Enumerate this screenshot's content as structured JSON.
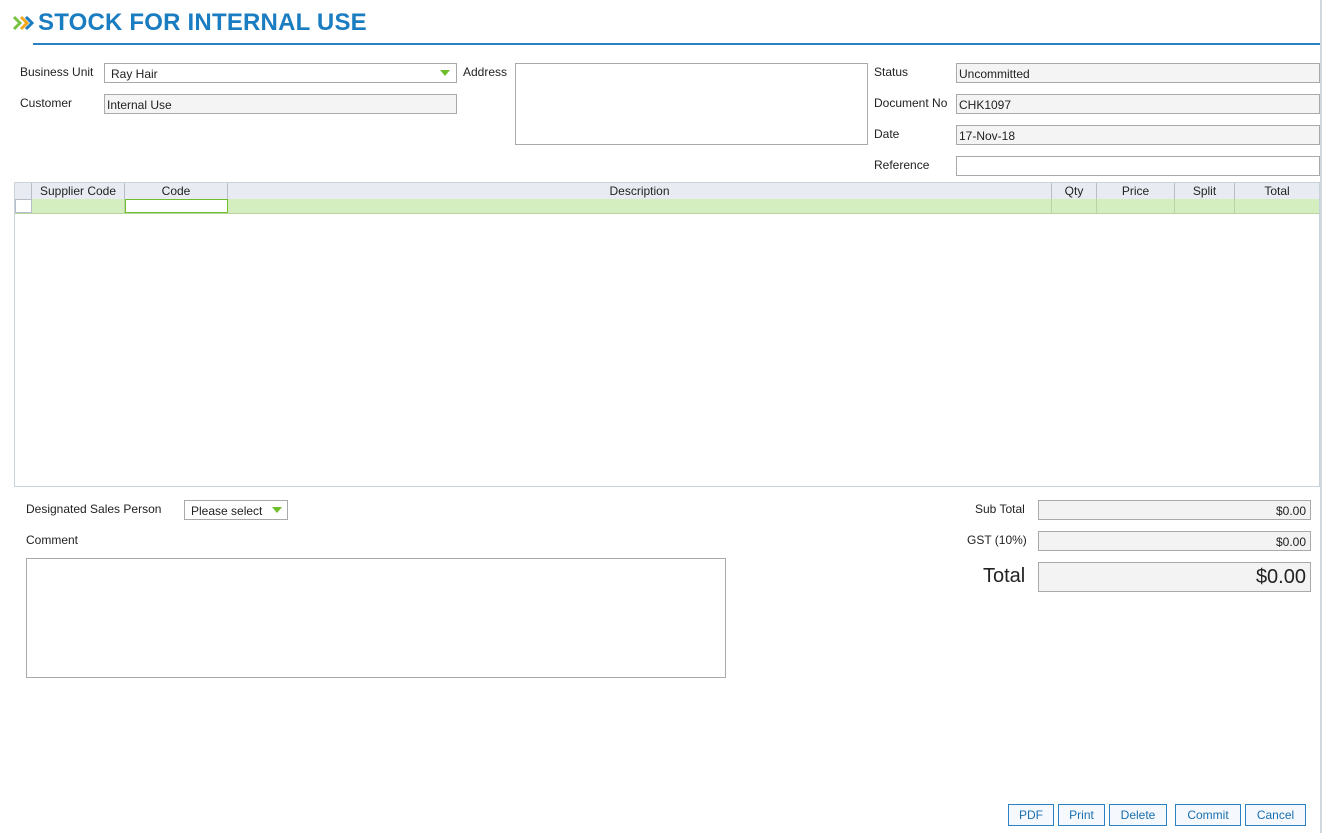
{
  "header": {
    "title": "STOCK FOR INTERNAL USE",
    "icon": "double-chevron-right-icon",
    "accent": "#1a7cc1"
  },
  "form": {
    "business_unit_label": "Business Unit",
    "business_unit_value": "Ray Hair",
    "customer_label": "Customer",
    "customer_value": "Internal Use",
    "address_label": "Address",
    "address_value": "",
    "status_label": "Status",
    "status_value": "Uncommitted",
    "document_no_label": "Document No",
    "document_no_value": "CHK1097",
    "date_label": "Date",
    "date_value": "17-Nov-18",
    "reference_label": "Reference",
    "reference_value": ""
  },
  "grid": {
    "columns": [
      "",
      "Supplier Code",
      "Code",
      "Description",
      "Qty",
      "Price",
      "Split",
      "Total"
    ],
    "row_color": "#d4eec0"
  },
  "footer": {
    "sales_person_label": "Designated Sales Person",
    "sales_person_value": "Please select",
    "comment_label": "Comment",
    "comment_value": "",
    "subtotal_label": "Sub Total",
    "subtotal_value": "$0.00",
    "gst_label": "GST (10%)",
    "gst_value": "$0.00",
    "total_label": "Total",
    "total_value": "$0.00"
  },
  "buttons": {
    "pdf": "PDF",
    "print": "Print",
    "delete": "Delete",
    "commit": "Commit",
    "cancel": "Cancel"
  }
}
